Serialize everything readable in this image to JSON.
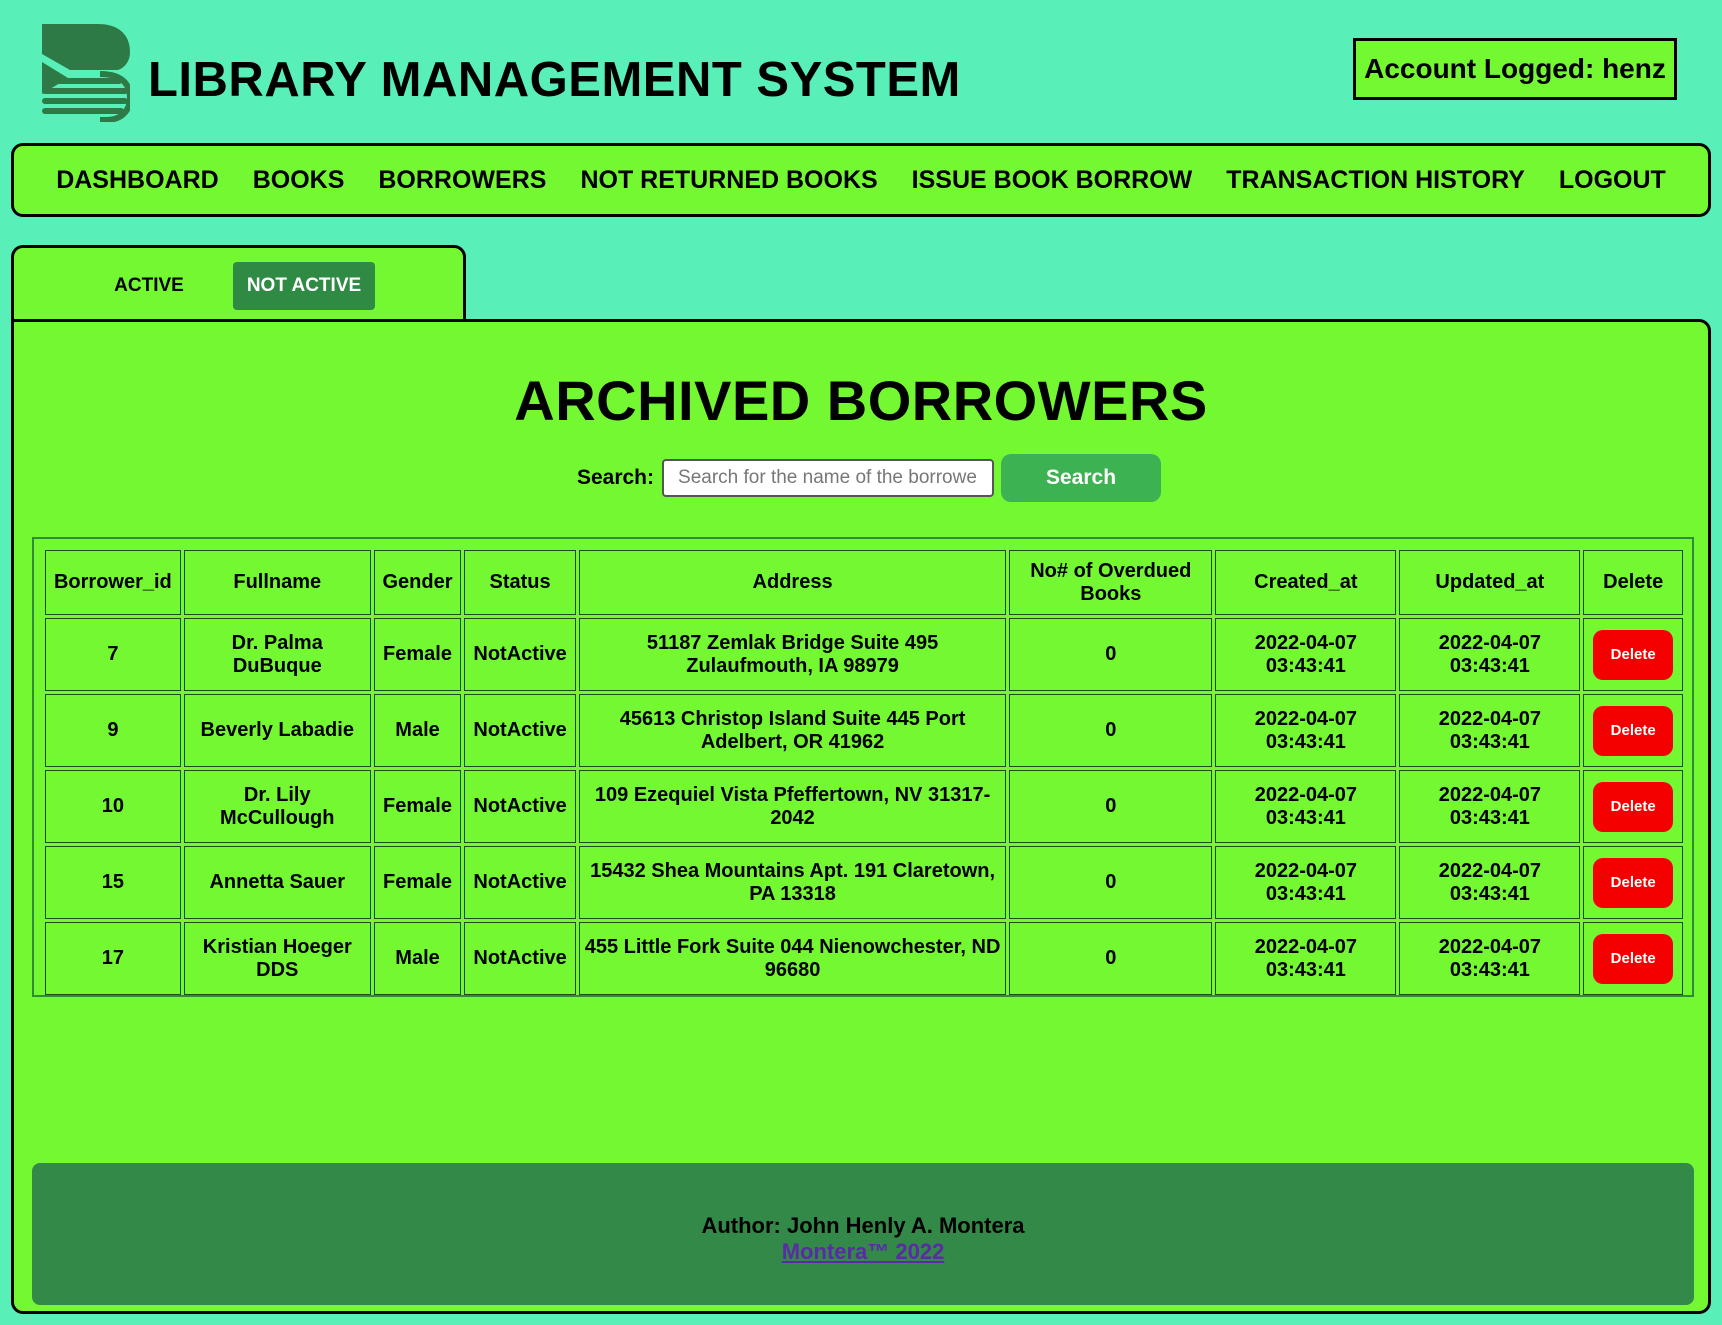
{
  "app": {
    "title": "LIBRARY MANAGEMENT SYSTEM",
    "account_label": "Account Logged: henz",
    "logo_icon": "book-stack-logo-icon"
  },
  "nav": {
    "items": [
      {
        "label": "DASHBOARD"
      },
      {
        "label": "BOOKS"
      },
      {
        "label": "BORROWERS"
      },
      {
        "label": "NOT RETURNED BOOKS"
      },
      {
        "label": "ISSUE BOOK BORROW"
      },
      {
        "label": "TRANSACTION HISTORY"
      },
      {
        "label": "LOGOUT"
      }
    ]
  },
  "tabs": {
    "active": "ACTIVE",
    "not_active": "NOT ACTIVE",
    "selected": "NOT ACTIVE"
  },
  "page": {
    "heading": "ARCHIVED BORROWERS",
    "search_label": "Search:",
    "search_placeholder": "Search for the name of the borrower..",
    "search_value": "",
    "search_button": "Search"
  },
  "table": {
    "headers": [
      "Borrower_id",
      "Fullname",
      "Gender",
      "Status",
      "Address",
      "No# of Overdued Books",
      "Created_at",
      "Updated_at",
      "Delete"
    ],
    "rows": [
      {
        "id": "7",
        "fullname": "Dr. Palma DuBuque",
        "gender": "Female",
        "status": "NotActive",
        "address": "51187 Zemlak Bridge Suite 495 Zulaufmouth, IA 98979",
        "overdue": "0",
        "created_at": "2022-04-07 03:43:41",
        "updated_at": "2022-04-07 03:43:41",
        "delete": "Delete"
      },
      {
        "id": "9",
        "fullname": "Beverly Labadie",
        "gender": "Male",
        "status": "NotActive",
        "address": "45613 Christop Island Suite 445 Port Adelbert, OR 41962",
        "overdue": "0",
        "created_at": "2022-04-07 03:43:41",
        "updated_at": "2022-04-07 03:43:41",
        "delete": "Delete"
      },
      {
        "id": "10",
        "fullname": "Dr. Lily McCullough",
        "gender": "Female",
        "status": "NotActive",
        "address": "109 Ezequiel Vista Pfeffertown, NV 31317-2042",
        "overdue": "0",
        "created_at": "2022-04-07 03:43:41",
        "updated_at": "2022-04-07 03:43:41",
        "delete": "Delete"
      },
      {
        "id": "15",
        "fullname": "Annetta Sauer",
        "gender": "Female",
        "status": "NotActive",
        "address": "15432 Shea Mountains Apt. 191 Claretown, PA 13318",
        "overdue": "0",
        "created_at": "2022-04-07 03:43:41",
        "updated_at": "2022-04-07 03:43:41",
        "delete": "Delete"
      },
      {
        "id": "17",
        "fullname": "Kristian Hoeger DDS",
        "gender": "Male",
        "status": "NotActive",
        "address": "455 Little Fork Suite 044 Nienowchester, ND 96680",
        "overdue": "0",
        "created_at": "2022-04-07 03:43:41",
        "updated_at": "2022-04-07 03:43:41",
        "delete": "Delete"
      }
    ]
  },
  "footer": {
    "author": "Author: John Henly A. Montera",
    "link_text": "Montera™ 2022"
  },
  "colors": {
    "background": "#58f0b8",
    "panel": "#74f832",
    "tab_selected": "#2f8a43",
    "search_button": "#3db253",
    "delete_button": "#f40000",
    "footer": "#338a48"
  }
}
